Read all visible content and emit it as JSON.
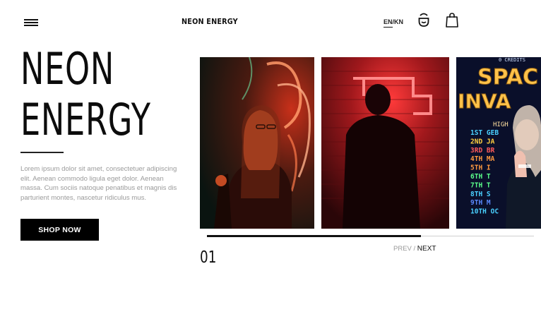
{
  "header": {
    "brand": "NEON ENERGY",
    "lang_active": "EN",
    "lang_separator": "/",
    "lang_other": "KN",
    "icons": [
      "menu-icon",
      "user-icon",
      "bag-icon"
    ]
  },
  "hero": {
    "title_line1": "NEON",
    "title_line2": "ENERGY",
    "description": "Lorem ipsum dolor sit amet, consectetuer adipiscing elit. Aenean commodo ligula eget dolor. Aenean massa. Cum sociis natoque penatibus et magnis dis parturient montes, nascetur ridiculus mus.",
    "cta_label": "SHOP NOW"
  },
  "slider": {
    "counter": "01",
    "prev_label": "PREV",
    "pager_separator": "/",
    "next_label": "NEXT",
    "progress_fraction": 0.655,
    "slides": [
      {
        "name": "slide-neon-sign-woman",
        "accent": "#ff5a2a"
      },
      {
        "name": "slide-red-neon-man",
        "accent": "#ff2030"
      },
      {
        "name": "slide-arcade-scoreboard",
        "accent": "#2ab8ff"
      }
    ],
    "arcade_sign": {
      "top_text": "0 CREDITS",
      "headline_1": "SPAC",
      "headline_2": "INVA",
      "score_header": "HIGH",
      "rows": [
        "1ST GEB",
        "2ND JA",
        "3RD BR",
        "4TH MA",
        "5TH I",
        "6TH T",
        "7TH T",
        "8TH S",
        "9TH M",
        "10TH OC"
      ]
    }
  },
  "colors": {
    "primary": "#000000",
    "muted_text": "#9a9a9a",
    "track": "#cfcfcf"
  }
}
